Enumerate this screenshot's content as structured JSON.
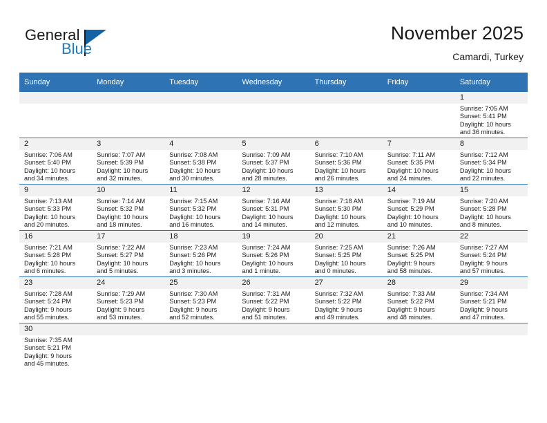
{
  "brand": {
    "name_top": "General",
    "name_bottom": "Blue",
    "accent_color": "#1464a5",
    "blue_text_color": "#1f7bc1",
    "logo_icon": "triangle-flag-icon"
  },
  "header": {
    "title": "November 2025",
    "subtitle": "Camardi, Turkey"
  },
  "calendar": {
    "header_bg": "#2e74b5",
    "daynum_bg": "#f1f1f1",
    "weekday_headers": [
      "Sunday",
      "Monday",
      "Tuesday",
      "Wednesday",
      "Thursday",
      "Friday",
      "Saturday"
    ],
    "weeks": [
      [
        {
          "day": "",
          "sunrise": "",
          "sunset": "",
          "daylight_line1": "",
          "daylight_line2": "",
          "empty": true
        },
        {
          "day": "",
          "sunrise": "",
          "sunset": "",
          "daylight_line1": "",
          "daylight_line2": "",
          "empty": true
        },
        {
          "day": "",
          "sunrise": "",
          "sunset": "",
          "daylight_line1": "",
          "daylight_line2": "",
          "empty": true
        },
        {
          "day": "",
          "sunrise": "",
          "sunset": "",
          "daylight_line1": "",
          "daylight_line2": "",
          "empty": true
        },
        {
          "day": "",
          "sunrise": "",
          "sunset": "",
          "daylight_line1": "",
          "daylight_line2": "",
          "empty": true
        },
        {
          "day": "",
          "sunrise": "",
          "sunset": "",
          "daylight_line1": "",
          "daylight_line2": "",
          "empty": true
        },
        {
          "day": "1",
          "sunrise": "Sunrise: 7:05 AM",
          "sunset": "Sunset: 5:41 PM",
          "daylight_line1": "Daylight: 10 hours",
          "daylight_line2": "and 36 minutes.",
          "empty": false
        }
      ],
      [
        {
          "day": "2",
          "sunrise": "Sunrise: 7:06 AM",
          "sunset": "Sunset: 5:40 PM",
          "daylight_line1": "Daylight: 10 hours",
          "daylight_line2": "and 34 minutes.",
          "empty": false
        },
        {
          "day": "3",
          "sunrise": "Sunrise: 7:07 AM",
          "sunset": "Sunset: 5:39 PM",
          "daylight_line1": "Daylight: 10 hours",
          "daylight_line2": "and 32 minutes.",
          "empty": false
        },
        {
          "day": "4",
          "sunrise": "Sunrise: 7:08 AM",
          "sunset": "Sunset: 5:38 PM",
          "daylight_line1": "Daylight: 10 hours",
          "daylight_line2": "and 30 minutes.",
          "empty": false
        },
        {
          "day": "5",
          "sunrise": "Sunrise: 7:09 AM",
          "sunset": "Sunset: 5:37 PM",
          "daylight_line1": "Daylight: 10 hours",
          "daylight_line2": "and 28 minutes.",
          "empty": false
        },
        {
          "day": "6",
          "sunrise": "Sunrise: 7:10 AM",
          "sunset": "Sunset: 5:36 PM",
          "daylight_line1": "Daylight: 10 hours",
          "daylight_line2": "and 26 minutes.",
          "empty": false
        },
        {
          "day": "7",
          "sunrise": "Sunrise: 7:11 AM",
          "sunset": "Sunset: 5:35 PM",
          "daylight_line1": "Daylight: 10 hours",
          "daylight_line2": "and 24 minutes.",
          "empty": false
        },
        {
          "day": "8",
          "sunrise": "Sunrise: 7:12 AM",
          "sunset": "Sunset: 5:34 PM",
          "daylight_line1": "Daylight: 10 hours",
          "daylight_line2": "and 22 minutes.",
          "empty": false
        }
      ],
      [
        {
          "day": "9",
          "sunrise": "Sunrise: 7:13 AM",
          "sunset": "Sunset: 5:33 PM",
          "daylight_line1": "Daylight: 10 hours",
          "daylight_line2": "and 20 minutes.",
          "empty": false
        },
        {
          "day": "10",
          "sunrise": "Sunrise: 7:14 AM",
          "sunset": "Sunset: 5:32 PM",
          "daylight_line1": "Daylight: 10 hours",
          "daylight_line2": "and 18 minutes.",
          "empty": false
        },
        {
          "day": "11",
          "sunrise": "Sunrise: 7:15 AM",
          "sunset": "Sunset: 5:32 PM",
          "daylight_line1": "Daylight: 10 hours",
          "daylight_line2": "and 16 minutes.",
          "empty": false
        },
        {
          "day": "12",
          "sunrise": "Sunrise: 7:16 AM",
          "sunset": "Sunset: 5:31 PM",
          "daylight_line1": "Daylight: 10 hours",
          "daylight_line2": "and 14 minutes.",
          "empty": false
        },
        {
          "day": "13",
          "sunrise": "Sunrise: 7:18 AM",
          "sunset": "Sunset: 5:30 PM",
          "daylight_line1": "Daylight: 10 hours",
          "daylight_line2": "and 12 minutes.",
          "empty": false
        },
        {
          "day": "14",
          "sunrise": "Sunrise: 7:19 AM",
          "sunset": "Sunset: 5:29 PM",
          "daylight_line1": "Daylight: 10 hours",
          "daylight_line2": "and 10 minutes.",
          "empty": false
        },
        {
          "day": "15",
          "sunrise": "Sunrise: 7:20 AM",
          "sunset": "Sunset: 5:28 PM",
          "daylight_line1": "Daylight: 10 hours",
          "daylight_line2": "and 8 minutes.",
          "empty": false
        }
      ],
      [
        {
          "day": "16",
          "sunrise": "Sunrise: 7:21 AM",
          "sunset": "Sunset: 5:28 PM",
          "daylight_line1": "Daylight: 10 hours",
          "daylight_line2": "and 6 minutes.",
          "empty": false
        },
        {
          "day": "17",
          "sunrise": "Sunrise: 7:22 AM",
          "sunset": "Sunset: 5:27 PM",
          "daylight_line1": "Daylight: 10 hours",
          "daylight_line2": "and 5 minutes.",
          "empty": false
        },
        {
          "day": "18",
          "sunrise": "Sunrise: 7:23 AM",
          "sunset": "Sunset: 5:26 PM",
          "daylight_line1": "Daylight: 10 hours",
          "daylight_line2": "and 3 minutes.",
          "empty": false
        },
        {
          "day": "19",
          "sunrise": "Sunrise: 7:24 AM",
          "sunset": "Sunset: 5:26 PM",
          "daylight_line1": "Daylight: 10 hours",
          "daylight_line2": "and 1 minute.",
          "empty": false
        },
        {
          "day": "20",
          "sunrise": "Sunrise: 7:25 AM",
          "sunset": "Sunset: 5:25 PM",
          "daylight_line1": "Daylight: 10 hours",
          "daylight_line2": "and 0 minutes.",
          "empty": false
        },
        {
          "day": "21",
          "sunrise": "Sunrise: 7:26 AM",
          "sunset": "Sunset: 5:25 PM",
          "daylight_line1": "Daylight: 9 hours",
          "daylight_line2": "and 58 minutes.",
          "empty": false
        },
        {
          "day": "22",
          "sunrise": "Sunrise: 7:27 AM",
          "sunset": "Sunset: 5:24 PM",
          "daylight_line1": "Daylight: 9 hours",
          "daylight_line2": "and 57 minutes.",
          "empty": false
        }
      ],
      [
        {
          "day": "23",
          "sunrise": "Sunrise: 7:28 AM",
          "sunset": "Sunset: 5:24 PM",
          "daylight_line1": "Daylight: 9 hours",
          "daylight_line2": "and 55 minutes.",
          "empty": false
        },
        {
          "day": "24",
          "sunrise": "Sunrise: 7:29 AM",
          "sunset": "Sunset: 5:23 PM",
          "daylight_line1": "Daylight: 9 hours",
          "daylight_line2": "and 53 minutes.",
          "empty": false
        },
        {
          "day": "25",
          "sunrise": "Sunrise: 7:30 AM",
          "sunset": "Sunset: 5:23 PM",
          "daylight_line1": "Daylight: 9 hours",
          "daylight_line2": "and 52 minutes.",
          "empty": false
        },
        {
          "day": "26",
          "sunrise": "Sunrise: 7:31 AM",
          "sunset": "Sunset: 5:22 PM",
          "daylight_line1": "Daylight: 9 hours",
          "daylight_line2": "and 51 minutes.",
          "empty": false
        },
        {
          "day": "27",
          "sunrise": "Sunrise: 7:32 AM",
          "sunset": "Sunset: 5:22 PM",
          "daylight_line1": "Daylight: 9 hours",
          "daylight_line2": "and 49 minutes.",
          "empty": false
        },
        {
          "day": "28",
          "sunrise": "Sunrise: 7:33 AM",
          "sunset": "Sunset: 5:22 PM",
          "daylight_line1": "Daylight: 9 hours",
          "daylight_line2": "and 48 minutes.",
          "empty": false
        },
        {
          "day": "29",
          "sunrise": "Sunrise: 7:34 AM",
          "sunset": "Sunset: 5:21 PM",
          "daylight_line1": "Daylight: 9 hours",
          "daylight_line2": "and 47 minutes.",
          "empty": false
        }
      ],
      [
        {
          "day": "30",
          "sunrise": "Sunrise: 7:35 AM",
          "sunset": "Sunset: 5:21 PM",
          "daylight_line1": "Daylight: 9 hours",
          "daylight_line2": "and 45 minutes.",
          "empty": false
        },
        {
          "day": "",
          "sunrise": "",
          "sunset": "",
          "daylight_line1": "",
          "daylight_line2": "",
          "empty": true
        },
        {
          "day": "",
          "sunrise": "",
          "sunset": "",
          "daylight_line1": "",
          "daylight_line2": "",
          "empty": true
        },
        {
          "day": "",
          "sunrise": "",
          "sunset": "",
          "daylight_line1": "",
          "daylight_line2": "",
          "empty": true
        },
        {
          "day": "",
          "sunrise": "",
          "sunset": "",
          "daylight_line1": "",
          "daylight_line2": "",
          "empty": true
        },
        {
          "day": "",
          "sunrise": "",
          "sunset": "",
          "daylight_line1": "",
          "daylight_line2": "",
          "empty": true
        },
        {
          "day": "",
          "sunrise": "",
          "sunset": "",
          "daylight_line1": "",
          "daylight_line2": "",
          "empty": true
        }
      ]
    ]
  }
}
